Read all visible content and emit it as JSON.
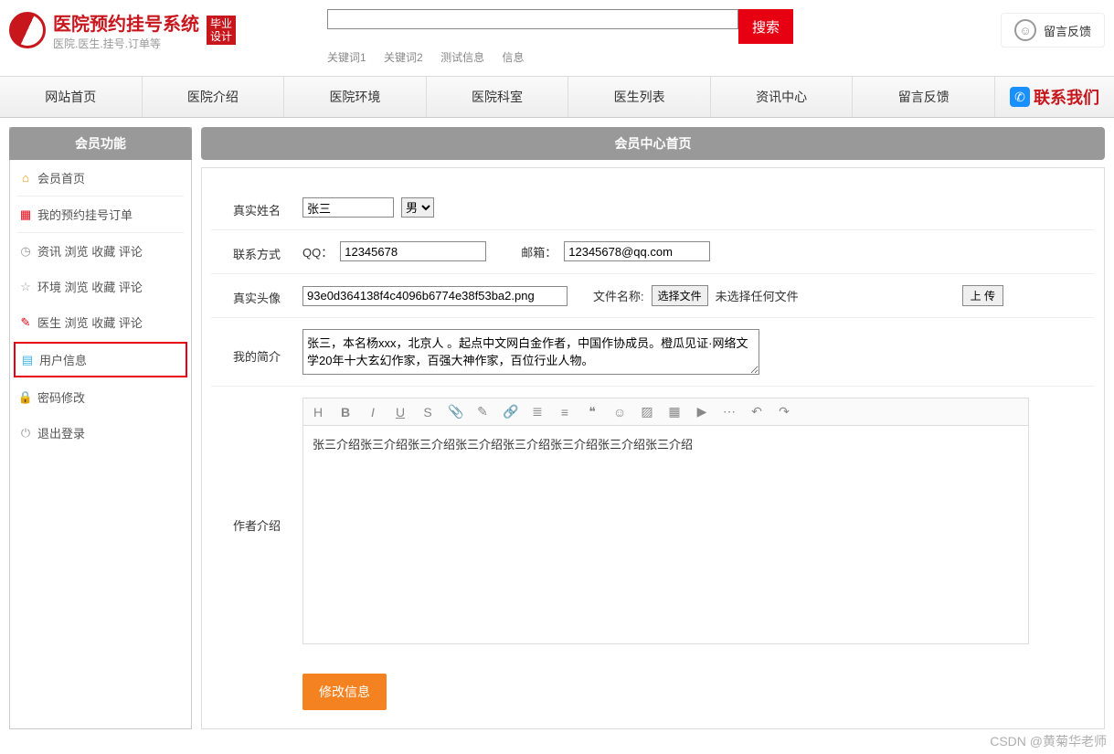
{
  "header": {
    "system_name": "医院预约挂号系统",
    "system_sub": "医院.医生.挂号.订单等",
    "badge_line1": "毕业",
    "badge_line2": "设计",
    "search_button": "搜索",
    "keywords": [
      "关键词1",
      "关键词2",
      "测试信息",
      "信息"
    ],
    "feedback": "留言反馈"
  },
  "nav": {
    "items": [
      "网站首页",
      "医院介绍",
      "医院环境",
      "医院科室",
      "医生列表",
      "资讯中心",
      "留言反馈"
    ],
    "contact": "联系我们"
  },
  "sidebar": {
    "title": "会员功能",
    "items": [
      {
        "label": "会员首页"
      },
      {
        "label": "我的预约挂号订单"
      },
      {
        "label": "资讯 浏览 收藏 评论"
      },
      {
        "label": "环境 浏览 收藏 评论"
      },
      {
        "label": "医生 浏览 收藏 评论"
      },
      {
        "label": "用户信息"
      },
      {
        "label": "密码修改"
      },
      {
        "label": "退出登录"
      }
    ]
  },
  "main": {
    "title": "会员中心首页",
    "labels": {
      "real_name": "真实姓名",
      "contact": "联系方式",
      "avatar": "真实头像",
      "profile": "我的简介",
      "author_intro": "作者介绍",
      "qq": "QQ：",
      "email": "邮箱：",
      "file_name": "文件名称:",
      "choose_file": "选择文件",
      "no_file": "未选择任何文件",
      "upload": "上 传",
      "submit": "修改信息"
    },
    "values": {
      "real_name": "张三",
      "gender": "男",
      "qq": "12345678",
      "email": "12345678@qq.com",
      "avatar_file": "93e0d364138f4c4096b6774e38f53ba2.png",
      "profile_text": "张三，本名杨xxx，北京人 。起点中文网白金作者，中国作协成员。橙瓜见证·网络文学20年十大玄幻作家，百强大神作家，百位行业人物。",
      "author_intro_text": "张三介绍张三介绍张三介绍张三介绍张三介绍张三介绍张三介绍张三介绍"
    }
  },
  "watermark": "CSDN @黄菊华老师"
}
